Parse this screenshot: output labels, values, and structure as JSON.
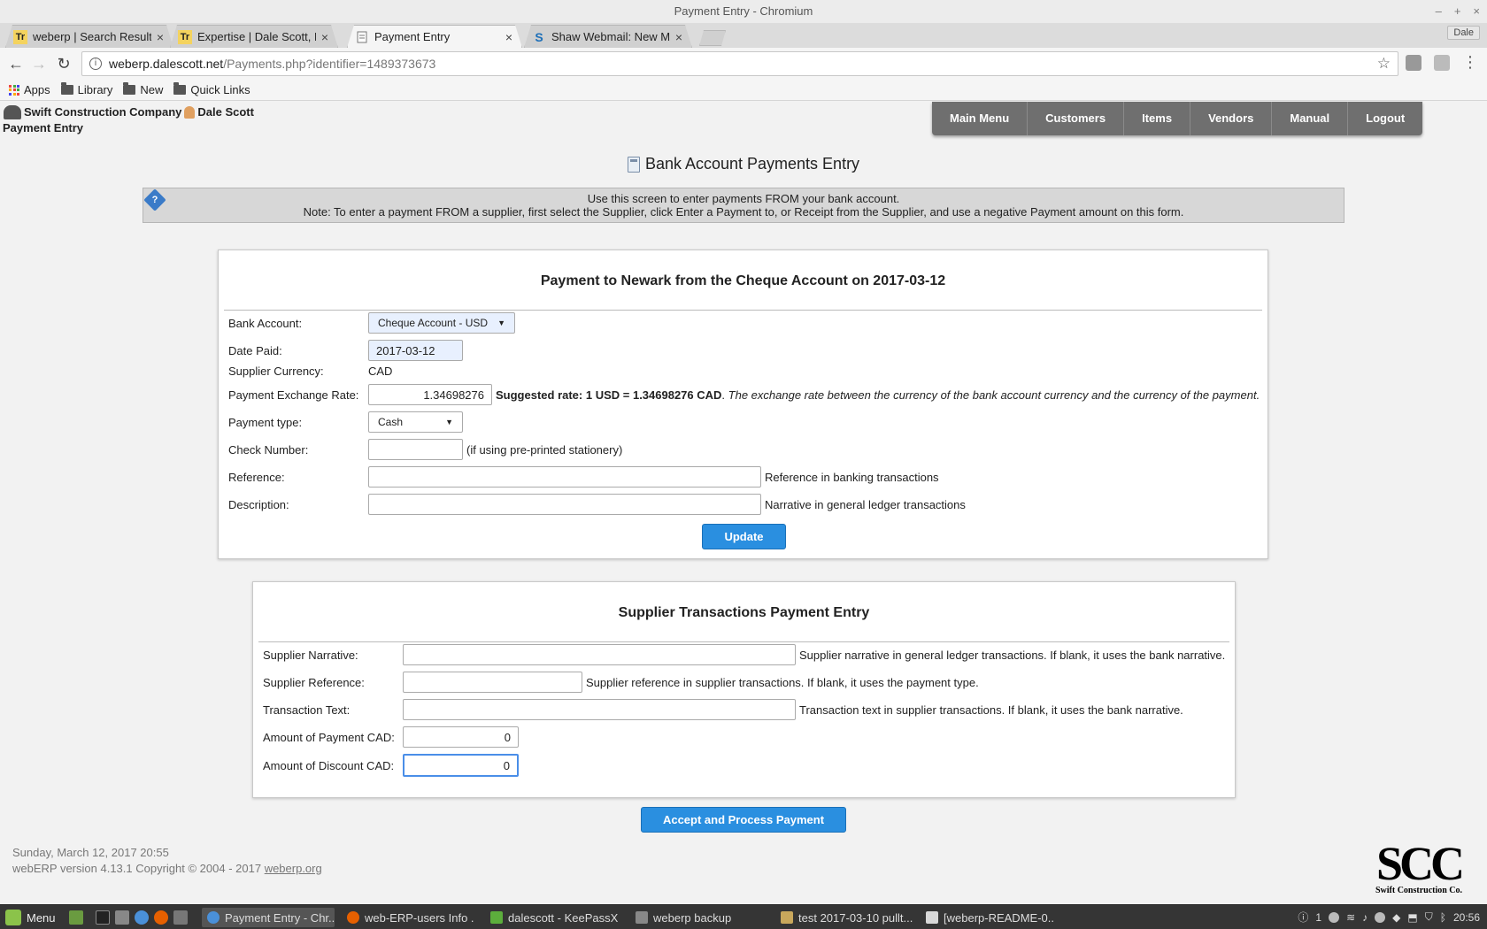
{
  "window": {
    "title": "Payment Entry - Chromium",
    "controls": [
      "–",
      "+",
      "×"
    ]
  },
  "tabs": [
    {
      "label": "weberp | Search Result",
      "icon": "Tr",
      "close": "×"
    },
    {
      "label": "Expertise | Dale Scott, P",
      "icon": "Tr",
      "close": "×"
    },
    {
      "label": "Payment Entry",
      "icon": "",
      "close": "×"
    },
    {
      "label": "Shaw Webmail: New Me",
      "icon": "S",
      "close": "×"
    }
  ],
  "profile": "Dale",
  "address": {
    "host": "weberp.dalescott.net",
    "path": "/Payments.php?identifier=1489373673"
  },
  "bookmarks": [
    "Apps",
    "Library",
    "New",
    "Quick Links"
  ],
  "header": {
    "company": "Swift Construction Company",
    "user": "Dale Scott",
    "subtitle": "Payment Entry",
    "nav": [
      "Main Menu",
      "Customers",
      "Items",
      "Vendors",
      "Manual",
      "Logout"
    ]
  },
  "title": "Bank Account Payments Entry",
  "note": {
    "line1": "Use this screen to enter payments FROM your bank account.",
    "line2": "Note: To enter a payment FROM a supplier, first select the Supplier, click Enter a Payment to, or Receipt from the Supplier, and use a negative Payment amount on this form."
  },
  "payment": {
    "heading": "Payment to Newark from the Cheque Account on 2017-03-12",
    "bank_account_label": "Bank Account:",
    "bank_account_value": "Cheque Account - USD",
    "date_paid_label": "Date Paid:",
    "date_paid_value": "2017-03-12",
    "supplier_currency_label": "Supplier Currency:",
    "supplier_currency_value": "CAD",
    "exchange_rate_label": "Payment Exchange Rate:",
    "exchange_rate_value": "1.34698276",
    "suggested_rate": "Suggested rate: 1 USD = 1.34698276 CAD",
    "exchange_rate_note": "The exchange rate between the currency of the bank account currency and the currency of the payment.",
    "payment_type_label": "Payment type:",
    "payment_type_value": "Cash",
    "check_number_label": "Check Number:",
    "check_number_hint": "(if using pre-printed stationery)",
    "reference_label": "Reference:",
    "reference_hint": "Reference in banking transactions",
    "description_label": "Description:",
    "description_hint": "Narrative in general ledger transactions",
    "update_label": "Update"
  },
  "supplier": {
    "heading": "Supplier Transactions Payment Entry",
    "narrative_label": "Supplier Narrative:",
    "narrative_hint": "Supplier narrative in general ledger transactions. If blank, it uses the bank narrative.",
    "reference_label": "Supplier Reference:",
    "reference_hint": "Supplier reference in supplier transactions. If blank, it uses the payment type.",
    "text_label": "Transaction Text:",
    "text_hint": "Transaction text in supplier transactions. If blank, it uses the bank narrative.",
    "amount_label": "Amount of Payment CAD:",
    "amount_value": "0",
    "discount_label": "Amount of Discount CAD:",
    "discount_value": "0"
  },
  "accept_label": "Accept and Process Payment",
  "footer": {
    "date": "Sunday, March 12, 2017 20:55",
    "version": "webERP version 4.13.1 Copyright © 2004 - 2017 ",
    "link": "weberp.org",
    "logo_big": "SCC",
    "logo_small": "Swift Construction Co."
  },
  "taskbar": {
    "menu": "Menu",
    "tasks": [
      "Payment Entry - Chr...",
      "web-ERP-users Info ...",
      "dalescott - KeePassX",
      "weberp backup",
      "test 2017-03-10 pullt...",
      "[weberp-README-0..."
    ],
    "tray_count": "1",
    "clock": "20:56"
  },
  "colors": {
    "accent": "#2a8fe0",
    "nav": "#6f6f6f"
  }
}
